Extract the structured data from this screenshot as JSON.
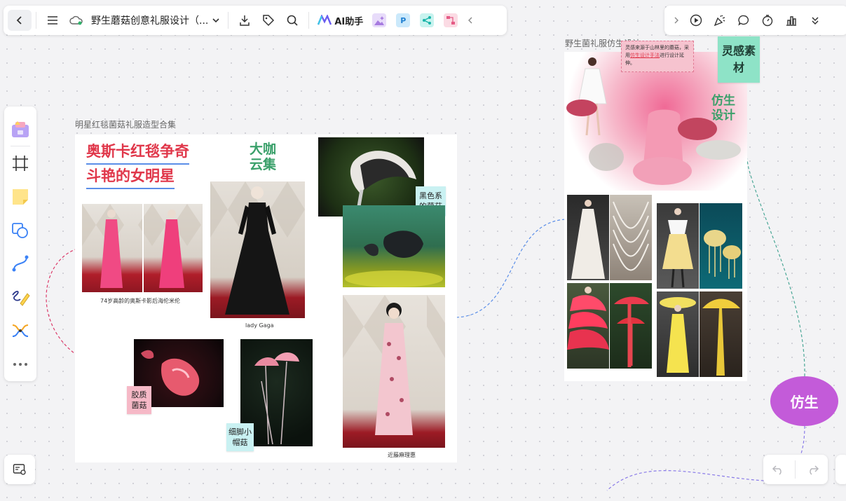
{
  "toolbar": {
    "document_title": "野生蘑菇创意礼服设计（...",
    "ai_assistant_label": "AI助手",
    "plugin_p_label": "P"
  },
  "boards": {
    "left": {
      "label": "明星红毯菌菇礼服造型合集",
      "headline_line1": "奥斯卡红毯争奇",
      "headline_line2": "斗艳的女明星",
      "subheadline_line1": "大咖",
      "subheadline_line2": "云集",
      "captions": {
        "helen": "74岁高龄的奥斯卡影后海伦米伦",
        "gaga": "lady Gaga",
        "kondo": "近藤麻理惠"
      },
      "stickies": {
        "black_mushroom": "黑色系的菌菇",
        "jelly_mushroom": "胶质菌菇",
        "thin_leg_mushroom": "细脚小帽菇"
      }
    },
    "right": {
      "label": "野生菌礼服仿生设计",
      "note_text_before": "灵感来源于山林里的蘑菇，采用",
      "note_link": "仿生设计手法",
      "note_text_after": "进行设计延伸。",
      "sticky_inspiration": "灵感素材",
      "headline_line1": "仿生",
      "headline_line2": "设计"
    }
  },
  "mind_node": {
    "label": "仿生"
  },
  "colors": {
    "headline_red": "#e0374a",
    "headline_green": "#3aa06a",
    "sticky_pink": "#f6b9c7",
    "sticky_cyan": "#c9f1f2",
    "sticky_mint": "#8ee3c7",
    "node_purple": "#c35bd9",
    "connector_blue": "#5a8ee8",
    "connector_pink": "#dc3b6a",
    "connector_green": "#4aa796"
  }
}
